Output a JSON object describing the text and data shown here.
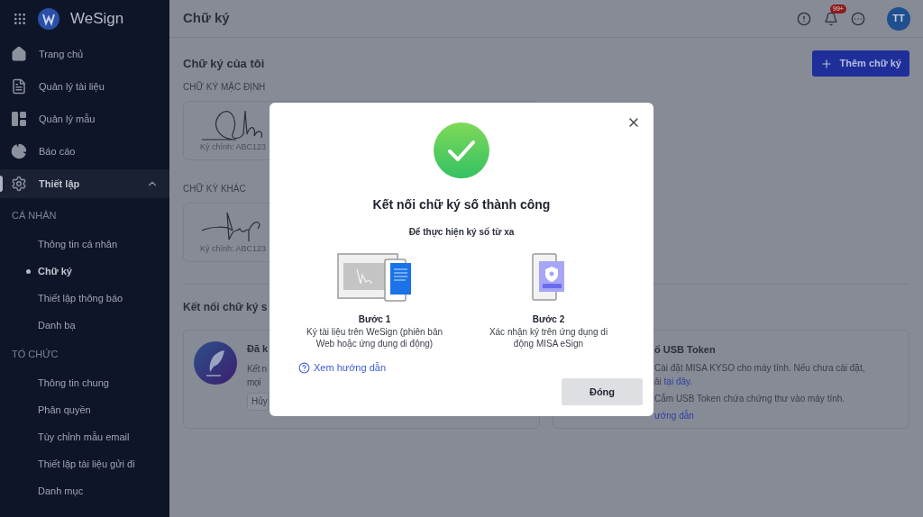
{
  "sidebar": {
    "app_name": "WeSign",
    "items": [
      {
        "label": "Trang chủ",
        "selected": false
      },
      {
        "label": "Quản lý tài liệu",
        "selected": false
      },
      {
        "label": "Quản lý mẫu",
        "selected": false
      },
      {
        "label": "Báo cáo",
        "selected": false
      },
      {
        "label": "Thiết lập",
        "selected": true,
        "expanded": true
      }
    ],
    "groups": [
      {
        "heading": "CÁ NHÂN",
        "items": [
          {
            "label": "Thông tin cá nhân",
            "selected": false
          },
          {
            "label": "Chữ ký",
            "selected": true
          },
          {
            "label": "Thiết lập thông báo",
            "selected": false
          },
          {
            "label": "Danh bạ",
            "selected": false
          }
        ]
      },
      {
        "heading": "TỔ CHỨC",
        "items": [
          {
            "label": "Thông tin chung",
            "selected": false
          },
          {
            "label": "Phân quyền",
            "selected": false
          },
          {
            "label": "Tùy chỉnh mẫu email",
            "selected": false
          },
          {
            "label": "Thiết lập tài liệu gửi đi",
            "selected": false
          },
          {
            "label": "Danh mục",
            "selected": false
          }
        ]
      }
    ]
  },
  "header": {
    "title": "Chữ ký",
    "notification_badge": "99+",
    "avatar": "TT"
  },
  "page": {
    "section_title": "Chữ ký của tôi",
    "add_button": "Thêm chữ ký",
    "signatures": [
      {
        "label": "CHỮ KÝ MẶC ĐỊNH",
        "caption": "Ký chính: ABC123"
      },
      {
        "label": "CHỮ KÝ KHÁC",
        "caption": "Ký chính: ABC123"
      }
    ],
    "connect_heading": "Kết nối chữ ký s",
    "remote_card": {
      "title": "Đã k",
      "lines": [
        "Kết n",
        "mọi"
      ],
      "button": "Hủy"
    },
    "usb_card": {
      "title": "ố USB Token",
      "step_1": "Cài đặt MISA KYSO cho máy tính. Nếu chưa cài đặt,",
      "step_1_prefix": "ải",
      "step_1_link": "tại đây.",
      "step_2": "Cắm USB Token chứa chứng thư vào máy tính.",
      "guide_link": "ướng dẫn"
    }
  },
  "dialog": {
    "title": "Kết nối chữ ký số thành công",
    "subtitle": "Để thực hiện ký số từ xa",
    "steps": [
      {
        "title": "Bước 1",
        "text": "Ký tài liệu trên WeSign (phiên bản Web hoặc ứng dụng di động)"
      },
      {
        "title": "Bước 2",
        "text": "Xác nhận ký trên ứng dụng di động MISA eSign"
      }
    ],
    "help_link": "Xem hướng dẫn",
    "close_button": "Đóng"
  }
}
